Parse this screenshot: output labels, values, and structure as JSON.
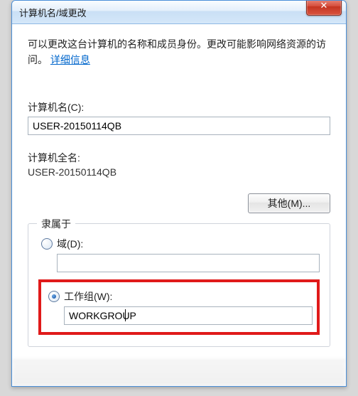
{
  "window": {
    "title": "计算机名/域更改"
  },
  "description": {
    "text_part1": "可以更改这台计算机的名称和成员身份。更改可能影响网络资源的访问。",
    "link_text": "详细信息"
  },
  "computer_name": {
    "label": "计算机名(C):",
    "value": "USER-20150114QB"
  },
  "full_name": {
    "label": "计算机全名:",
    "value": "USER-20150114QB"
  },
  "buttons": {
    "more_label": "其他(M)..."
  },
  "member_of": {
    "legend": "隶属于",
    "domain": {
      "label": "域(D):",
      "value": "",
      "checked": false
    },
    "workgroup": {
      "label": "工作组(W):",
      "value": "WORKGROUP",
      "checked": true
    }
  }
}
